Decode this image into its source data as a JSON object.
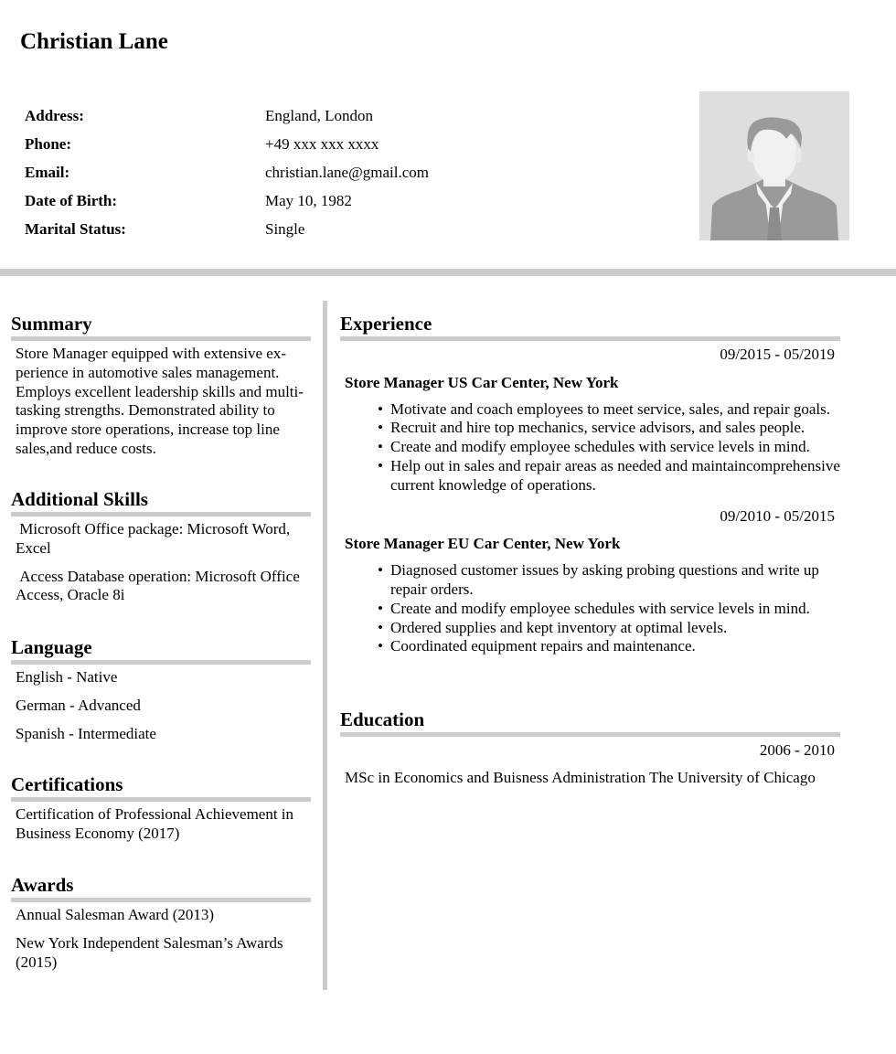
{
  "header": {
    "name": "Christian Lane",
    "info": [
      {
        "label": "Address:",
        "value": "England, London"
      },
      {
        "label": "Phone:",
        "value": "+49 xxx xxx xxxx"
      },
      {
        "label": "Email:",
        "value": "christian.lane@gmail.com"
      },
      {
        "label": "Date of Birth:",
        "value": "May 10, 1982"
      },
      {
        "label": "Marital Status:",
        "value": "Single"
      }
    ],
    "photo_icon": "avatar-placeholder-icon"
  },
  "left": {
    "summary": {
      "title": "Summary",
      "text": "Store Manager equipped with extensive ex­perience in automotive sales management. Employs excellent leadership skills and multi-tasking strengths. Demonstrated abil­ity to improve store operations, increase top line sales,and reduce costs."
    },
    "skills": {
      "title": "Additional Skills",
      "items": [
        " Microsoft Office package: Microsoft Word, Excel",
        " Access Database operation: Microsoft Of­fice Access, Oracle 8i"
      ]
    },
    "language": {
      "title": "Language",
      "items": [
        "English - Native",
        "German - Advanced",
        "Spanish - Intermediate"
      ]
    },
    "certifications": {
      "title": "Certifications",
      "items": [
        "Certification of Professional Achievement in Business Economy (2017)"
      ]
    },
    "awards": {
      "title": "Awards",
      "items": [
        "Annual Salesman Award (2013)",
        "New York Independent Salesman’s Awards (2015)"
      ]
    }
  },
  "right": {
    "experience": {
      "title": "Experience",
      "jobs": [
        {
          "dates": "09/2015 - 05/2019",
          "title": "Store Manager US Car Center, New York",
          "bullets": [
            "Motivate and coach employees to meet service, sales, and repair goals.",
            "Recruit and hire top mechanics, service advisors, and sales people.",
            "Create and modify employee schedules with service levels in mind.",
            "Help out in sales and repair areas as needed and maintaincompre­hensive current knowledge of operations."
          ]
        },
        {
          "dates": "09/2010 - 05/2015",
          "title": "Store Manager EU Car Center, New York",
          "bullets": [
            "Diagnosed customer issues by asking probing questions and write up repair orders.",
            "Create and modify employee schedules with service levels in mind.",
            "Ordered supplies and kept inventory at optimal levels.",
            "Coordinated equipment repairs and maintenance."
          ]
        }
      ]
    },
    "education": {
      "title": "Education",
      "dates": "2006 - 2010",
      "text": "MSc in Economics and Buisness Administration The University of Chica­go"
    }
  }
}
